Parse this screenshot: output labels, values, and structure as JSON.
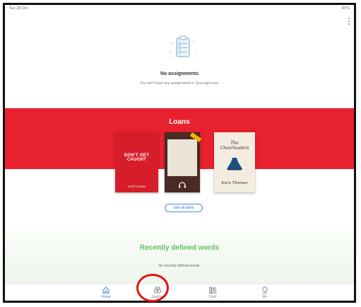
{
  "status_bar": {
    "time": "Tue 28 Oct",
    "battery": "93%"
  },
  "assignments": {
    "title": "No assignments",
    "subtitle": "You don't have any assignments in Sora right now."
  },
  "loans": {
    "title": "Loans",
    "books": [
      {
        "cover_title": "DON'T GET CAUGHT",
        "cover_author": "KURT DINAN",
        "color": "#d61e2a"
      },
      {
        "cover_title": "",
        "cover_author": "",
        "color": "#4a2a22",
        "format": "audiobook"
      },
      {
        "cover_title": "The Cheerleaders",
        "cover_author": "Kara Thomas",
        "color": "#f3ece0"
      }
    ],
    "see_all_label": "See all loans"
  },
  "recent_words": {
    "title": "Recently defined words",
    "subtitle": "No recently defined words."
  },
  "tabs": [
    {
      "label": "Home",
      "icon": "home-icon",
      "active": true
    },
    {
      "label": "Explore",
      "icon": "binoculars-icon",
      "active": false
    },
    {
      "label": "Shelf",
      "icon": "books-icon",
      "active": false
    },
    {
      "label": "Me",
      "icon": "profile-icon",
      "active": false
    }
  ],
  "colors": {
    "accent_red": "#e8212e",
    "words_green": "#5cc05a",
    "active_tab_blue": "#3e8ad8",
    "highlight_circle": "#e01515"
  }
}
